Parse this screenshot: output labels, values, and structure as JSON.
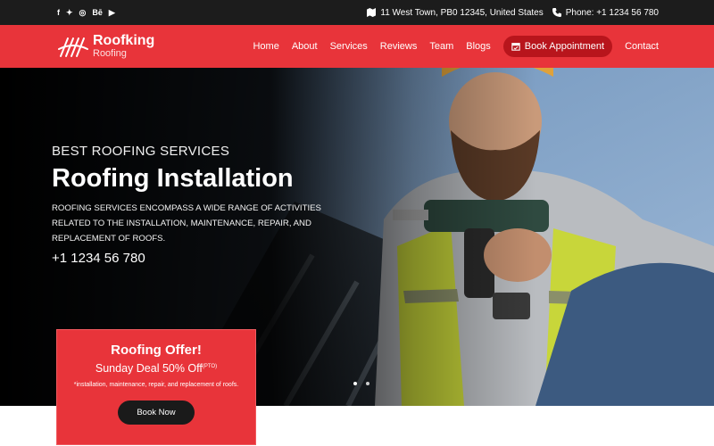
{
  "topbar": {
    "social": [
      {
        "icon": "facebook-icon",
        "glyph": "f"
      },
      {
        "icon": "twitter-icon",
        "glyph": "✦"
      },
      {
        "icon": "dribbble-icon",
        "glyph": "◎"
      },
      {
        "icon": "behance-icon",
        "glyph": "Bē"
      },
      {
        "icon": "youtube-icon",
        "glyph": "▶"
      }
    ],
    "address": "11 West Town, PB0 12345, United States",
    "phone": "Phone: +1 1234 56 780"
  },
  "nav": {
    "logo_title": "Roofking",
    "logo_sub": "Roofing",
    "items": [
      "Home",
      "About",
      "Services",
      "Reviews",
      "Team",
      "Blogs"
    ],
    "book_label": "Book Appointment",
    "contact_label": "Contact"
  },
  "hero": {
    "eyebrow": "BEST ROOFING SERVICES",
    "headline": "Roofing Installation",
    "description": "ROOFING SERVICES ENCOMPASS A WIDE RANGE OF ACTIVITIES RELATED TO THE INSTALLATION, MAINTENANCE, REPAIR, AND REPLACEMENT OF ROOFS.",
    "phone": "+1 1234 56 780",
    "slides": 2,
    "active_slide": 1
  },
  "offer": {
    "title": "Roofing Offer!",
    "deal": "Sunday Deal 50% Off",
    "deal_sup": "(PTO)",
    "note": "*installation, maintenance, repair, and replacement of roofs.",
    "button": "Book Now"
  },
  "colors": {
    "accent": "#e8343a",
    "accent_dark": "#b8151c",
    "topbar": "#1c1c1c",
    "button_dark": "#1a1a1a"
  }
}
